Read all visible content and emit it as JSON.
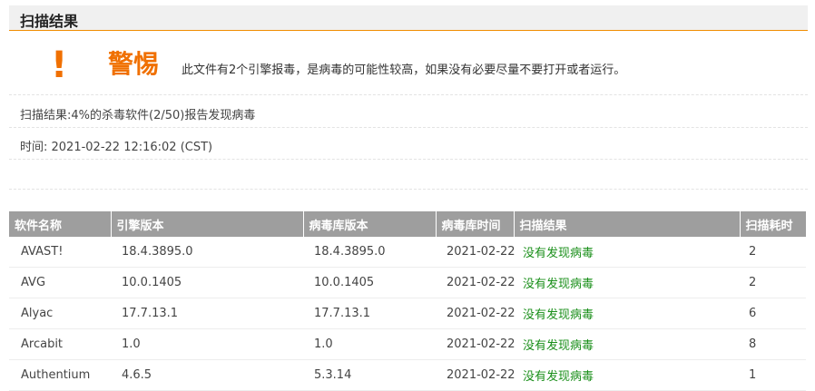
{
  "header": {
    "title": "扫描结果"
  },
  "warning": {
    "icon_glyph": "!",
    "icon_name": "exclamation-icon",
    "title": "警惕",
    "message": "此文件有2个引擎报毒，是病毒的可能性较高，如果没有必要尽量不要打开或者运行。"
  },
  "summary": {
    "scan_result": "扫描结果:4%的杀毒软件(2/50)报告发现病毒",
    "time": "时间: 2021-02-22 12:16:02 (CST)"
  },
  "table": {
    "headers": [
      "软件名称",
      "引擎版本",
      "病毒库版本",
      "病毒库时间",
      "扫描结果",
      "扫描耗时"
    ],
    "rows": [
      {
        "name": "AVAST!",
        "engine": "18.4.3895.0",
        "db": "18.4.3895.0",
        "date": "2021-02-22",
        "result": "没有发现病毒",
        "time": "2"
      },
      {
        "name": "AVG",
        "engine": "10.0.1405",
        "db": "10.0.1405",
        "date": "2021-02-22",
        "result": "没有发现病毒",
        "time": "2"
      },
      {
        "name": "Alyac",
        "engine": "17.7.13.1",
        "db": "17.7.13.1",
        "date": "2021-02-22",
        "result": "没有发现病毒",
        "time": "6"
      },
      {
        "name": "Arcabit",
        "engine": "1.0",
        "db": "1.0",
        "date": "2021-02-22",
        "result": "没有发现病毒",
        "time": "8"
      },
      {
        "name": "Authentium",
        "engine": "4.6.5",
        "db": "5.3.14",
        "date": "2021-02-22",
        "result": "没有发现病毒",
        "time": "1"
      }
    ]
  },
  "colors": {
    "accent": "#f07000",
    "clean": "#1a8f1a",
    "table_header_bg": "#9e9e9e"
  }
}
